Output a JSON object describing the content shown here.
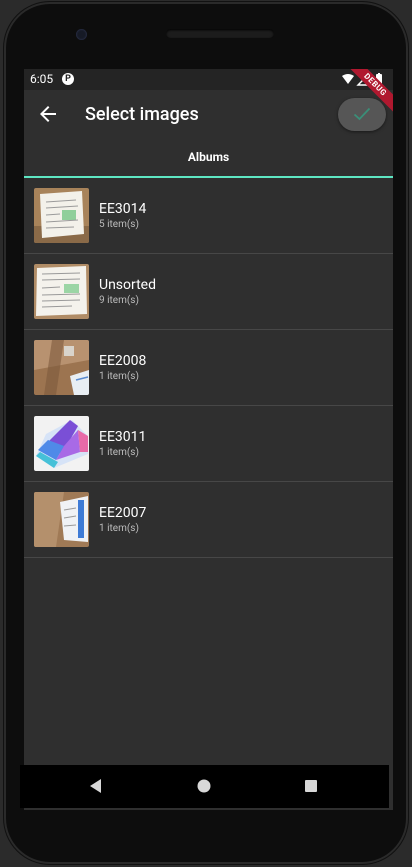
{
  "status_bar": {
    "time": "6:05",
    "app_icon_letter": "P",
    "debug_banner": "DEBUG"
  },
  "app_bar": {
    "title": "Select images",
    "back_icon": "arrow-back-icon",
    "confirm_icon": "check-icon"
  },
  "tabs": [
    {
      "label": "Albums",
      "active": true
    }
  ],
  "albums": [
    {
      "name": "EE3014",
      "count": "5 item(s)"
    },
    {
      "name": "Unsorted",
      "count": "9 item(s)"
    },
    {
      "name": "EE2008",
      "count": "1 item(s)"
    },
    {
      "name": "EE3011",
      "count": "1 item(s)"
    },
    {
      "name": "EE2007",
      "count": "1 item(s)"
    }
  ],
  "nav_bar": {
    "back": "triangle-back-icon",
    "home": "circle-home-icon",
    "recents": "square-recents-icon"
  },
  "colors": {
    "accent": "#5ee6c3",
    "surface": "#2f2f2f",
    "divider": "#474747",
    "debug": "#b0182f"
  }
}
